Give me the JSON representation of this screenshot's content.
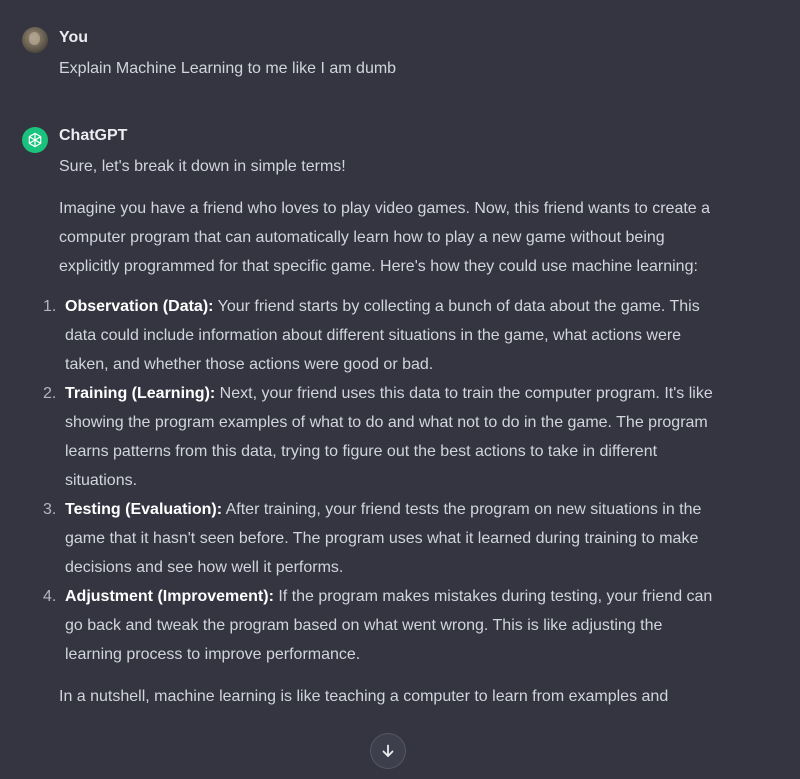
{
  "user_message": {
    "author": "You",
    "text": "Explain Machine Learning to me like I am dumb"
  },
  "assistant_message": {
    "author": "ChatGPT",
    "greeting": "Sure, let's break it down in simple terms!",
    "intro": "Imagine you have a friend who loves to play video games. Now, this friend wants to create a computer program that can automatically learn how to play a new game without being explicitly programmed for that specific game. Here's how they could use machine learning:",
    "steps": [
      {
        "num": "1.",
        "title": "Observation (Data):",
        "text": " Your friend starts by collecting a bunch of data about the game. This data could include information about different situations in the game, what actions were taken, and whether those actions were good or bad."
      },
      {
        "num": "2.",
        "title": "Training (Learning):",
        "text": " Next, your friend uses this data to train the computer program. It's like showing the program examples of what to do and what not to do in the game. The program learns patterns from this data, trying to figure out the best actions to take in different situations."
      },
      {
        "num": "3.",
        "title": "Testing (Evaluation):",
        "text": " After training, your friend tests the program on new situations in the game that it hasn't seen before. The program uses what it learned during training to make decisions and see how well it performs."
      },
      {
        "num": "4.",
        "title": "Adjustment (Improvement):",
        "text": " If the program makes mistakes during testing, your friend can go back and tweak the program based on what went wrong. This is like adjusting the learning process to improve performance."
      }
    ],
    "conclusion": "In a nutshell, machine learning is like teaching a computer to learn from examples and"
  },
  "icons": {
    "user_avatar": "user-photo-avatar",
    "assistant_avatar": "openai-logo-icon",
    "scroll_down": "arrow-down-icon"
  },
  "colors": {
    "background": "#343541",
    "text": "#d1d5db",
    "author": "#ececf1",
    "bold": "#ffffff",
    "assistant_avatar_bg": "#19c37d"
  }
}
